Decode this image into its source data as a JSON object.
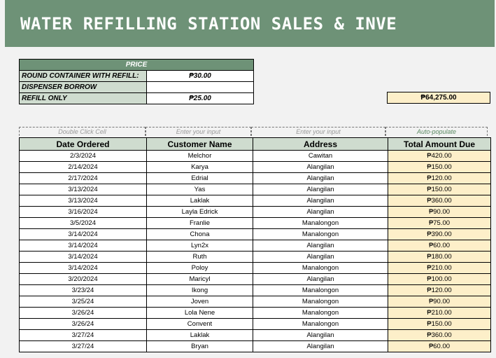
{
  "banner": {
    "title": "WATER REFILLING STATION SALES & INVE"
  },
  "price_table": {
    "header": "PRICE",
    "rows": [
      {
        "label": "ROUND CONTAINER WITH REFILL:",
        "value": "₱30.00"
      },
      {
        "label": "DISPENSER BORROW",
        "value": ""
      },
      {
        "label": "REFILL ONLY",
        "value": "₱25.00"
      }
    ]
  },
  "total_amount": "₱64,275.00",
  "hints": [
    "Double Click Cell",
    "Enter your input",
    "Enter your input",
    "Auto-populate"
  ],
  "columns": [
    "Date Ordered",
    "Customer Name",
    "Address",
    "Total Amount Due"
  ],
  "rows": [
    [
      "2/3/2024",
      "Melchor",
      "Cawitan",
      "₱420.00"
    ],
    [
      "2/14/2024",
      "Karya",
      "Alangilan",
      "₱150.00"
    ],
    [
      "2/17/2024",
      "Edrial",
      "Alangilan",
      "₱120.00"
    ],
    [
      "3/13/2024",
      "Yas",
      "Alangilan",
      "₱150.00"
    ],
    [
      "3/13/2024",
      "Laklak",
      "Alangilan",
      "₱360.00"
    ],
    [
      "3/16/2024",
      "Layla Edrick",
      "Alangilan",
      "₱90.00"
    ],
    [
      "3/5/2024",
      "Franlie",
      "Manalongon",
      "₱75.00"
    ],
    [
      "3/14/2024",
      "Chona",
      "Manalongon",
      "₱390.00"
    ],
    [
      "3/14/2024",
      "Lyn2x",
      "Alangilan",
      "₱60.00"
    ],
    [
      "3/14/2024",
      "Ruth",
      "Alangilan",
      "₱180.00"
    ],
    [
      "3/14/2024",
      "Poloy",
      "Manalongon",
      "₱210.00"
    ],
    [
      "3/20/2024",
      "Maricyl",
      "Alangilan",
      "₱100.00"
    ],
    [
      "3/23/24",
      "Ikong",
      "Manalongon",
      "₱120.00"
    ],
    [
      "3/25/24",
      "Joven",
      "Manalongon",
      "₱90.00"
    ],
    [
      "3/26/24",
      "Lola Nene",
      "Manalongon",
      "₱210.00"
    ],
    [
      "3/26/24",
      "Convent",
      "Manalongon",
      "₱150.00"
    ],
    [
      "3/27/24",
      "Laklak",
      "Alangilan",
      "₱360.00"
    ],
    [
      "3/27/24",
      "Bryan",
      "Alangilan",
      "₱60.00"
    ]
  ]
}
